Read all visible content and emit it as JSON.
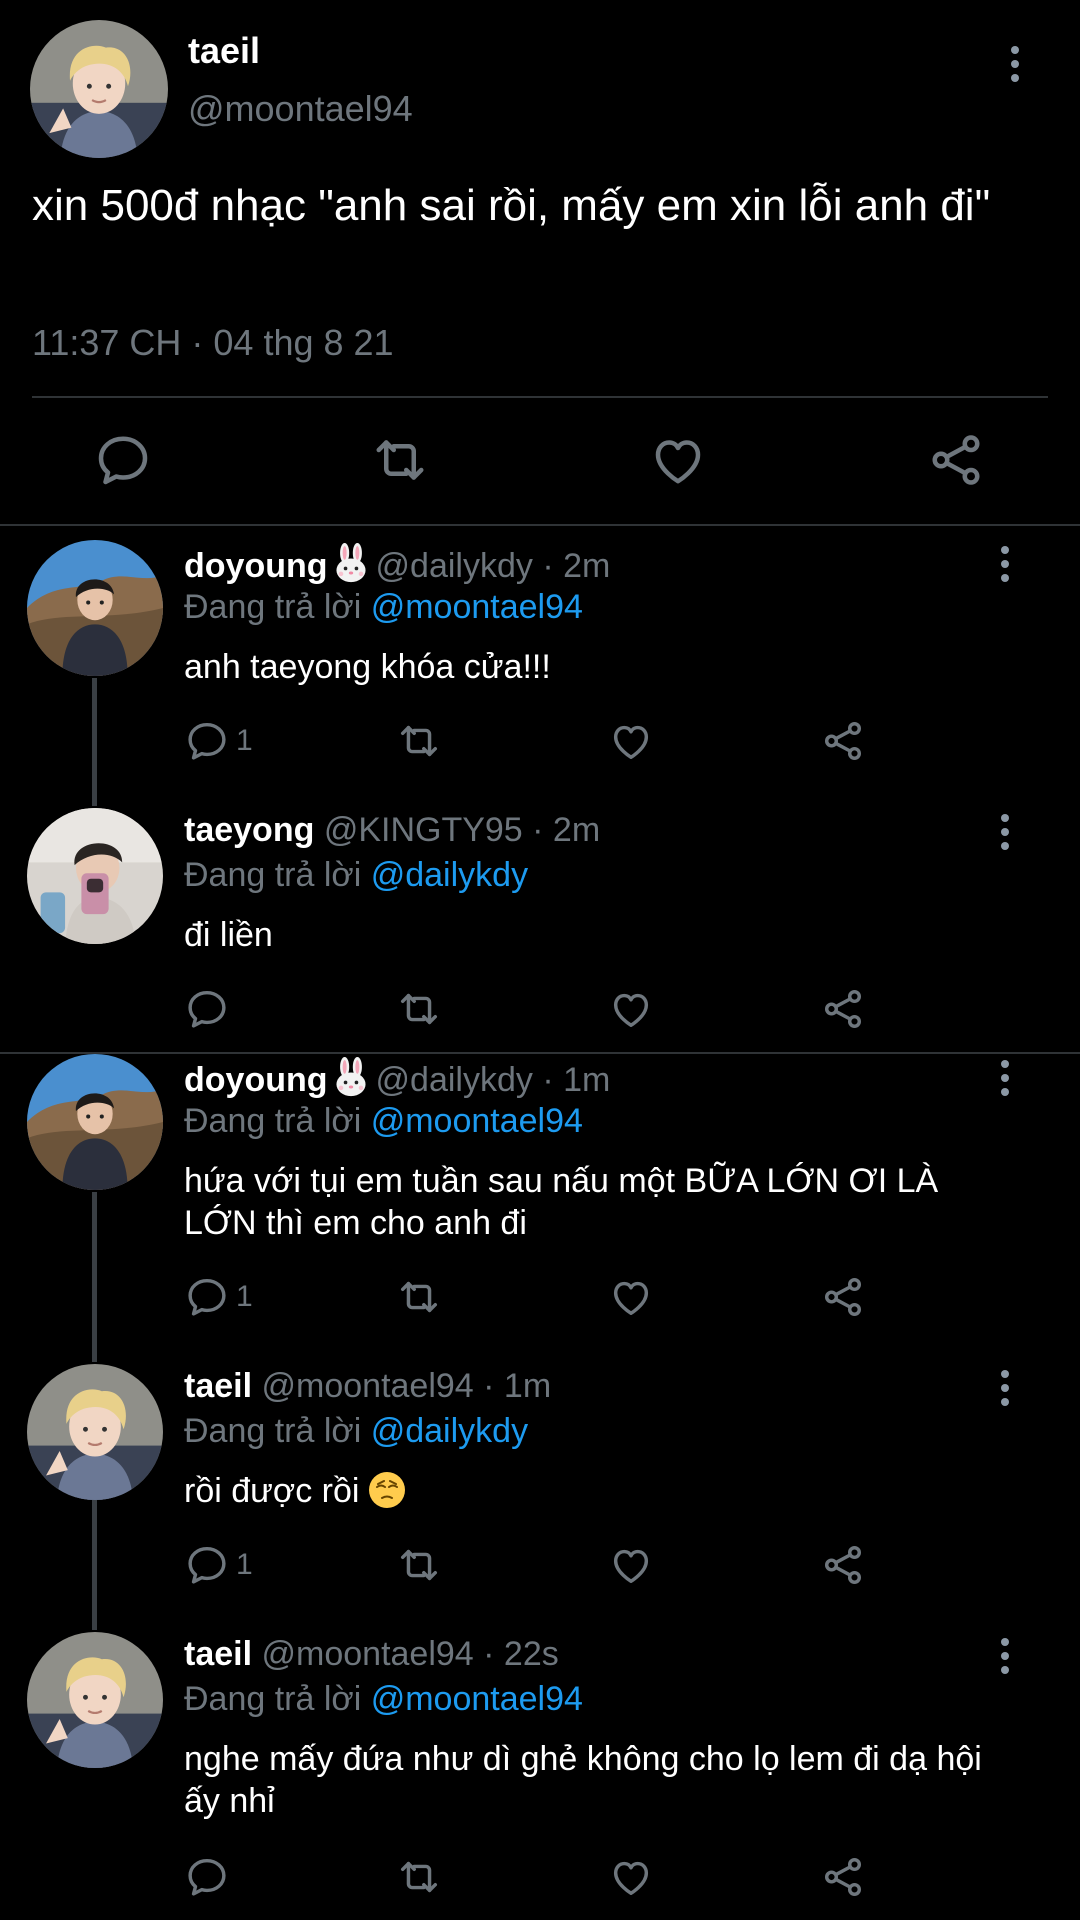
{
  "main_tweet": {
    "name": "taeil",
    "handle": "@moontael94",
    "text": "xin 500đ nhạc \"anh sai rồi, mấy em xin lỗi anh đi\"",
    "timestamp": "11:37 CH · 04 thg 8 21",
    "actions": [
      "reply-icon",
      "retweet-icon",
      "like-icon",
      "share-icon"
    ]
  },
  "replies": [
    {
      "name": "doyoung",
      "badge_icon": "rabbit-emoji",
      "handle_time": "@dailykdy · 2m",
      "replying_prefix": "Đang trả lời",
      "replying_to": "@moontael94",
      "text": "anh taeyong khóa cửa!!!",
      "reply_count": "1"
    },
    {
      "name": "taeyong",
      "handle_time": "@KINGTY95 · 2m",
      "replying_prefix": "Đang trả lời",
      "replying_to": "@dailykdy",
      "text": "đi liền",
      "reply_count": ""
    },
    {
      "name": "doyoung",
      "badge_icon": "rabbit-emoji",
      "handle_time": "@dailykdy · 1m",
      "replying_prefix": "Đang trả lời",
      "replying_to": "@moontael94",
      "text": "hứa với tụi em tuần sau nấu một BỮA LỚN ƠI LÀ LỚN thì em cho anh đi",
      "reply_count": "1"
    },
    {
      "name": "taeil",
      "handle_time": "@moontael94 · 1m",
      "replying_prefix": "Đang trả lời",
      "replying_to": "@dailykdy",
      "text": "rồi được rồi",
      "trailing_emoji": "pensive-face-emoji",
      "reply_count": "1"
    },
    {
      "name": "taeil",
      "handle_time": "@moontael94 · 22s",
      "replying_prefix": "Đang trả lời",
      "replying_to": "@moontael94",
      "text": "nghe mấy đứa như dì ghẻ không cho lọ lem đi dạ hội ấy nhỉ",
      "reply_count": ""
    }
  ],
  "colors": {
    "background": "#000000",
    "text": "#e7e9ea",
    "muted": "#6e767d",
    "link": "#1d9bf0",
    "divider": "#2f3336"
  }
}
